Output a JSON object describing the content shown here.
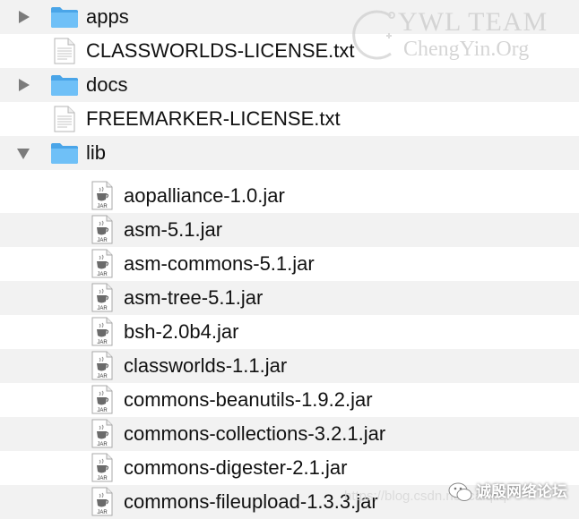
{
  "items": [
    {
      "name": "apps",
      "type": "folder",
      "expanded": false
    },
    {
      "name": "CLASSWORLDS-LICENSE.txt",
      "type": "text"
    },
    {
      "name": "docs",
      "type": "folder",
      "expanded": false
    },
    {
      "name": "FREEMARKER-LICENSE.txt",
      "type": "text"
    },
    {
      "name": "lib",
      "type": "folder",
      "expanded": true
    }
  ],
  "lib_children": [
    {
      "name": "aopalliance-1.0.jar",
      "type": "jar"
    },
    {
      "name": "asm-5.1.jar",
      "type": "jar"
    },
    {
      "name": "asm-commons-5.1.jar",
      "type": "jar"
    },
    {
      "name": "asm-tree-5.1.jar",
      "type": "jar"
    },
    {
      "name": "bsh-2.0b4.jar",
      "type": "jar"
    },
    {
      "name": "classworlds-1.1.jar",
      "type": "jar"
    },
    {
      "name": "commons-beanutils-1.9.2.jar",
      "type": "jar"
    },
    {
      "name": "commons-collections-3.2.1.jar",
      "type": "jar"
    },
    {
      "name": "commons-digester-2.1.jar",
      "type": "jar"
    },
    {
      "name": "commons-fileupload-1.3.3.jar",
      "type": "jar"
    }
  ],
  "watermark": {
    "title": "YWL TEAM",
    "subtitle": "ChengYin.Org",
    "bottom_url": "https://blog.csdn.net/caiqiiqi",
    "wechat_account": "诚殷网络论坛"
  },
  "jar_badge_text": "JAR",
  "colors": {
    "row_alt": "#f2f2f2",
    "folder": "#5ab1ef",
    "disclosure": "#7b7b7b",
    "text": "#111111"
  },
  "icons": {
    "folder": "folder-icon",
    "text_file": "text-document-icon",
    "jar_file": "jar-file-icon",
    "collapsed": "disclosure-triangle-right-icon",
    "expanded": "disclosure-triangle-down-icon"
  }
}
